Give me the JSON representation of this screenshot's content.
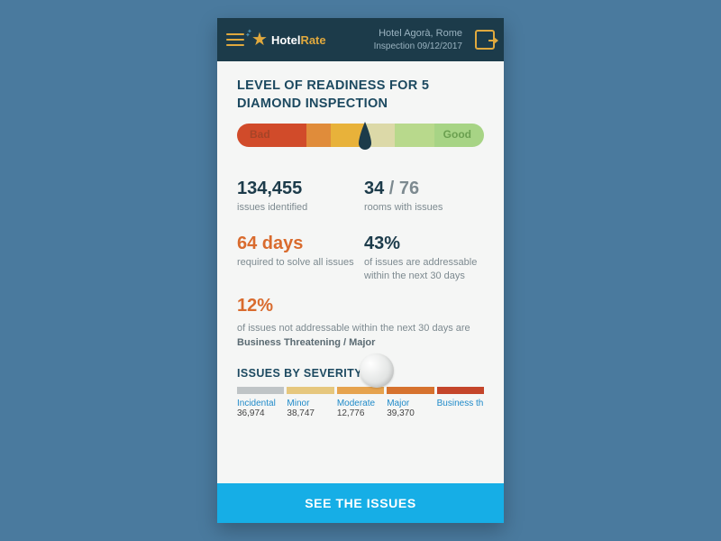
{
  "header": {
    "brand_a": "Hotel",
    "brand_b": "Rate",
    "hotel": "Hotel Agorà, Rome",
    "inspection": "Inspection 09/12/2017"
  },
  "title": "LEVEL OF READINESS FOR 5 DIAMOND INSPECTION",
  "gauge": {
    "bad_label": "Bad",
    "good_label": "Good"
  },
  "stats": {
    "issues_value": "134,455",
    "issues_label": "issues identified",
    "rooms_current": "34",
    "rooms_total": "76",
    "rooms_label": "rooms with issues",
    "days_value": "64 days",
    "days_label": "required to solve all issues",
    "pct_value": "43%",
    "pct_label": "of issues are addressable within the next 30 days"
  },
  "wide": {
    "pct": "12%",
    "line": "of issues not addressable within the next 30 days are",
    "bold": "Business Threatening / Major"
  },
  "severity_title": "ISSUES BY SEVERITY",
  "severity": [
    {
      "name": "Incidental",
      "value": "36,974"
    },
    {
      "name": "Minor",
      "value": "38,747"
    },
    {
      "name": "Moderate",
      "value": "12,776"
    },
    {
      "name": "Major",
      "value": "39,370"
    },
    {
      "name": "Business threating",
      "value": ""
    }
  ],
  "cta": "SEE THE ISSUES",
  "chart_data": {
    "type": "bar",
    "title": "Issues by severity",
    "categories": [
      "Incidental",
      "Minor",
      "Moderate",
      "Major",
      "Business threating"
    ],
    "values": [
      36974,
      38747,
      12776,
      39370,
      null
    ],
    "colors": [
      "#bfc4c6",
      "#e6c77d",
      "#e6a34e",
      "#d6722e",
      "#c4452a"
    ]
  }
}
